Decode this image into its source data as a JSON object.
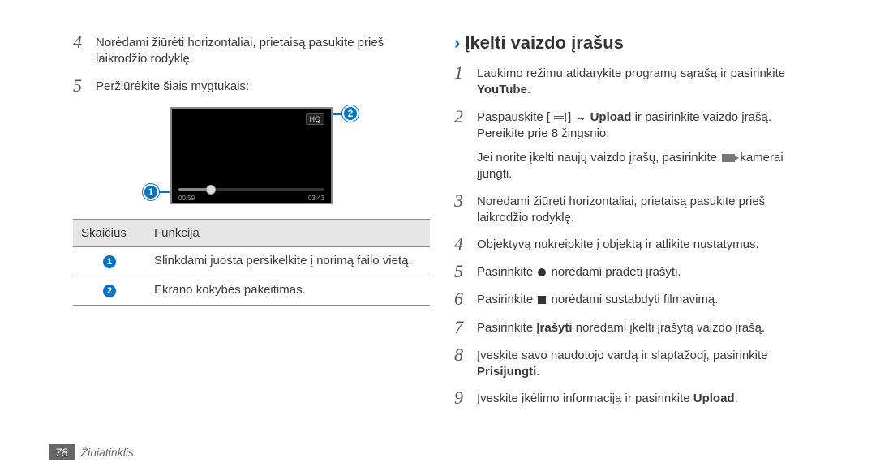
{
  "left": {
    "step4": "Norėdami žiūrėti horizontaliai, prietaisą pasukite prieš laikrodžio rodyklę.",
    "step5": "Peržiūrėkite šiais mygtukais:",
    "video": {
      "hq": "HQ",
      "time_cur": "00:59",
      "time_tot": "03:43"
    },
    "table": {
      "h1": "Skaičius",
      "h2": "Funkcija",
      "r1": "Slinkdami juosta persikelkite į norimą failo vietą.",
      "r2": "Ekrano kokybės pakeitimas."
    }
  },
  "right": {
    "heading": "Įkelti vaizdo įrašus",
    "s1a": "Laukimo režimu atidarykite programų sąrašą ir pasirinkite ",
    "s1b": "YouTube",
    "s2a": "Paspauskite [",
    "s2b": "] → ",
    "s2c": "Upload",
    "s2d": " ir pasirinkite vaizdo įrašą. Pereikite prie 8 žingsnio.",
    "s2note_a": "Jei norite įkelti naujų vaizdo įrašų, pasirinkite ",
    "s2note_b": " kamerai įjungti.",
    "s3": "Norėdami žiūrėti horizontaliai, prietaisą pasukite prieš laikrodžio rodyklę.",
    "s4": "Objektyvą nukreipkite į objektą ir atlikite nustatymus.",
    "s5a": "Pasirinkite ",
    "s5b": " norėdami pradėti įrašyti.",
    "s6a": "Pasirinkite ",
    "s6b": " norėdami sustabdyti filmavimą.",
    "s7a": "Pasirinkite ",
    "s7b": "Įrašyti",
    "s7c": " norėdami įkelti įrašytą vaizdo įrašą.",
    "s8a": "Įveskite savo naudotojo vardą ir slaptažodį, pasirinkite ",
    "s8b": "Prisijungti",
    "s9a": "Įveskite įkėlimo informaciją ir pasirinkite ",
    "s9b": "Upload"
  },
  "footer": {
    "pagenum": "78",
    "section": "Žiniatinklis"
  },
  "nums": {
    "n1": "1",
    "n2": "2",
    "n3": "3",
    "n4": "4",
    "n5": "5",
    "n6": "6",
    "n7": "7",
    "n8": "8",
    "n9": "9"
  }
}
